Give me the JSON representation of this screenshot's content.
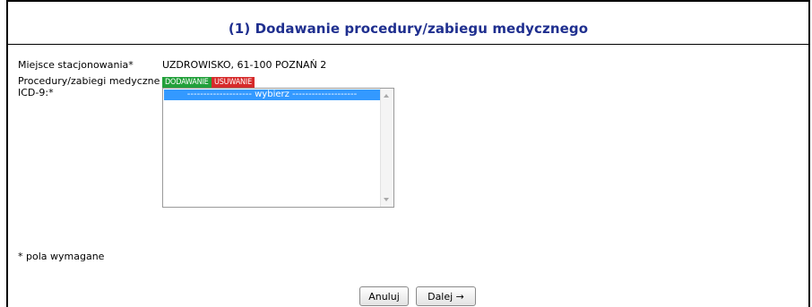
{
  "form": {
    "title": "(1) Dodawanie procedury/zabiegu medycznego",
    "location_label": "Miejsce stacjonowania*",
    "location_value": "UZDROWISKO, 61-100 POZNAŃ 2",
    "procedures_label_line1": "Procedury/zabiegi medyczne",
    "procedures_label_line2": "ICD-9:*",
    "add_badge": "DODAWANIE",
    "remove_badge": "USUWANIE",
    "listbox_selected": "-------------------- wybierz --------------------",
    "required_note": "* pola wymagane"
  },
  "buttons": {
    "cancel_label": "Anuluj",
    "next_label": "Dalej →"
  },
  "colors": {
    "title": "#1f2f8f",
    "add_badge": "#22a03a",
    "remove_badge": "#d62b2b",
    "selection": "#3399ff"
  }
}
